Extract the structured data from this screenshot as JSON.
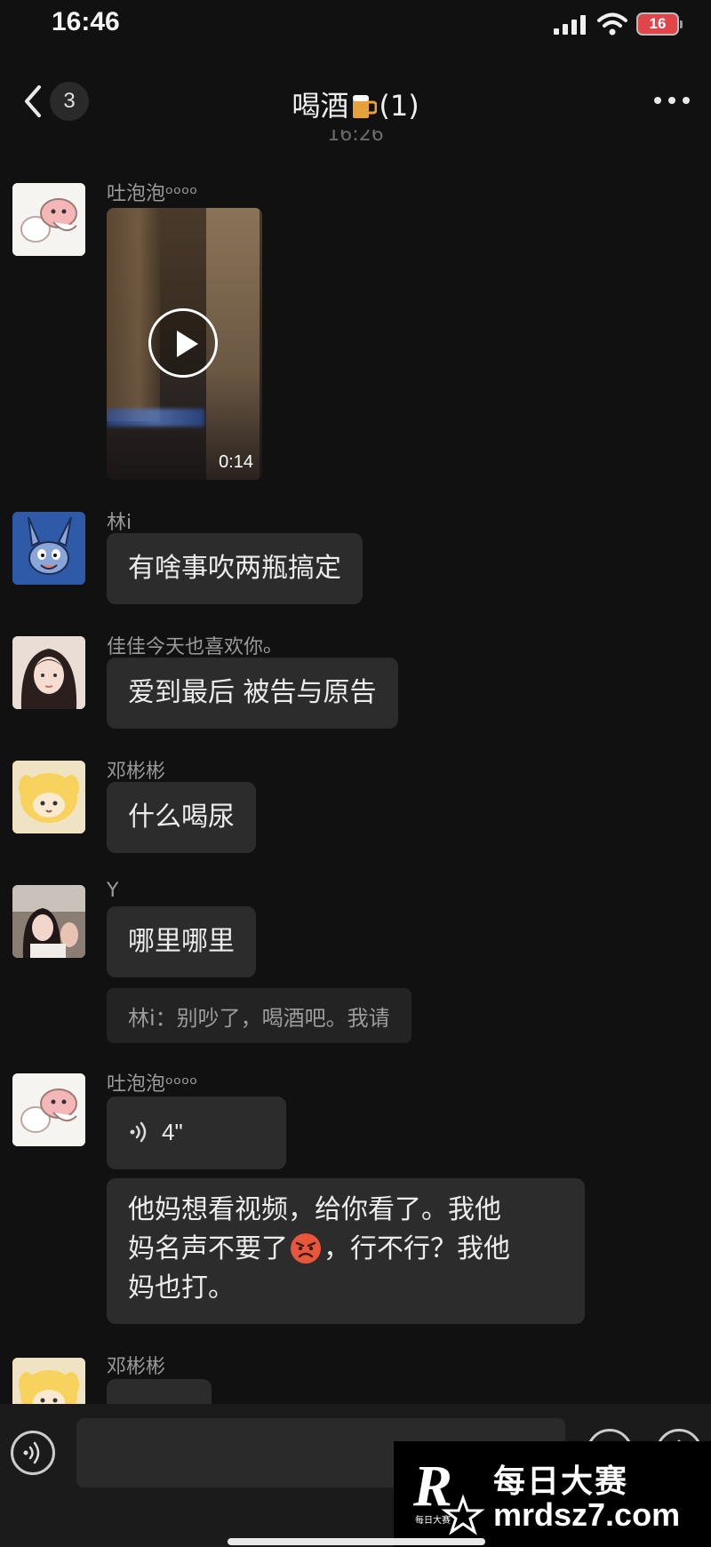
{
  "status_bar": {
    "time": "16:46",
    "battery": "16"
  },
  "nav": {
    "back_count": "3",
    "title_before_icon": "喝酒",
    "title_after_icon": "(1)",
    "timestamp_partial": "16:26"
  },
  "messages": [
    {
      "sender": "吐泡泡ᵒᵒᵒᵒ",
      "type": "video",
      "duration": "0:14"
    },
    {
      "sender": "林i",
      "type": "text",
      "text": "有啥事吹两瓶搞定"
    },
    {
      "sender": "佳佳今天也喜欢你ₒ",
      "type": "text",
      "text": "爱到最后 被告与原告"
    },
    {
      "sender": "邓彬彬",
      "type": "text",
      "text": "什么喝尿"
    },
    {
      "sender": "Y",
      "type": "text",
      "text": "哪里哪里",
      "quote": "林i：别吵了，喝酒吧。我请"
    },
    {
      "sender": "吐泡泡ᵒᵒᵒᵒ",
      "type": "voice",
      "duration": "4\""
    },
    {
      "sender": "",
      "type": "text",
      "text_line1": "他妈想看视频，给你看了。我他",
      "text_line2_before_emoji": "妈名声不要了",
      "text_line2_after_emoji": "，行不行？我他",
      "text_line3": "妈也打。"
    },
    {
      "sender": "邓彬彬",
      "type": "text",
      "text": ""
    }
  ],
  "watermark": {
    "line1": "每日大赛",
    "line2": "mrdsz7.com",
    "logo_text": "每日大赛"
  },
  "colors": {
    "background": "#111111",
    "bubble": "#2c2c2c",
    "battery": "#e0454a"
  }
}
